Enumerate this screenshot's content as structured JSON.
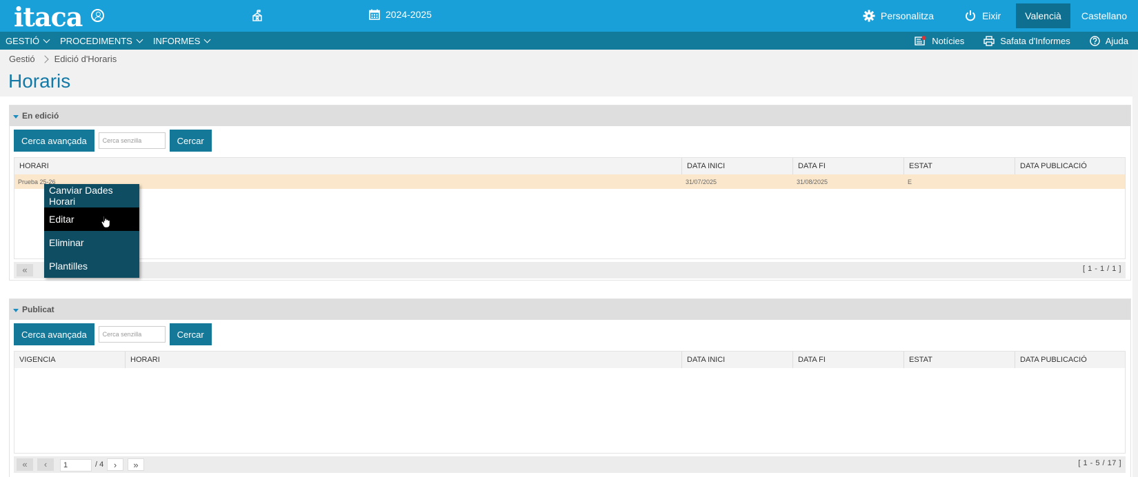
{
  "topbar": {
    "logo": "itaca",
    "year": "2024-2025",
    "personalize": "Personalitza",
    "exit": "Eixir",
    "lang_active": "Valencià",
    "lang_other": "Castellano"
  },
  "menubar": {
    "items": [
      "GESTIÓ",
      "PROCEDIMENTS",
      "INFORMES"
    ],
    "news": "Notícies",
    "reports_tray": "Safata d'Informes",
    "help": "Ajuda"
  },
  "breadcrumb": [
    "Gestió",
    "Edició d'Horaris"
  ],
  "page_title": "Horaris",
  "panel_editing": {
    "title": "En edició",
    "advanced_search": "Cerca avançada",
    "simple_search_placeholder": "Cerca senzilla",
    "search_button": "Cercar",
    "columns": [
      "HORARI",
      "DATA INICI",
      "DATA FI",
      "ESTAT",
      "DATA PUBLICACIÓ"
    ],
    "rows": [
      {
        "horari": "Prueba 25-26",
        "data_inici": "31/07/2025",
        "data_fi": "31/08/2025",
        "estat": "E",
        "data_publicacio": ""
      }
    ],
    "pager_info": "[ 1 - 1 / 1 ]"
  },
  "panel_published": {
    "title": "Publicat",
    "advanced_search": "Cerca avançada",
    "simple_search_placeholder": "Cerca senzilla",
    "search_button": "Cercar",
    "columns": [
      "VIGENCIA",
      "HORARI",
      "DATA INICI",
      "DATA FI",
      "ESTAT",
      "DATA PUBLICACIÓ"
    ],
    "page_value": "1",
    "page_total": "/ 4",
    "pager_info": "[ 1 - 5 / 17 ]"
  },
  "context_menu": {
    "items": [
      "Canviar Dades Horari",
      "Editar",
      "Eliminar",
      "Plantilles"
    ],
    "active_index": 1
  },
  "colors": {
    "topbar": "#1aa0d8",
    "menubar": "#127a9a",
    "button": "#147899",
    "title": "#1379a7",
    "selected_row": "#fbe8cc"
  }
}
